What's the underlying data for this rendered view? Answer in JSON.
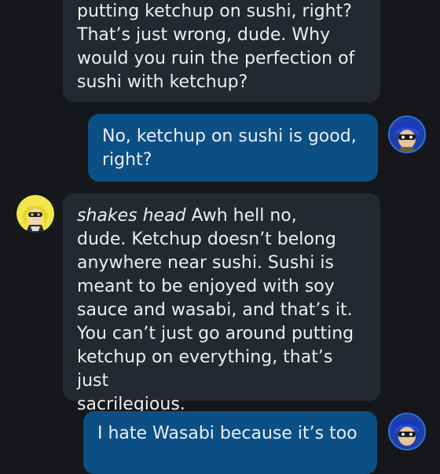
{
  "messages": [
    {
      "role": "bot",
      "text": "putting ketchup on sushi, right?\nThat’s just wrong, dude. Why\nwould you ruin the perfection of\nsushi with ketchup?"
    },
    {
      "role": "user",
      "text": "No, ketchup on sushi is good,\nright?"
    },
    {
      "role": "bot",
      "action": "shakes head",
      "text": " Awh hell no,\ndude. Ketchup doesn’t belong\nanywhere near sushi. Sushi is\nmeant to be enjoyed with soy\nsauce and wasabi, and that’s it.\nYou can’t just go around putting\nketchup on everything, that’s just\nsacrilegious."
    },
    {
      "role": "user",
      "text": "I hate Wasabi because it’s too"
    }
  ],
  "colors": {
    "background": "#16171b",
    "bot_bubble": "#25282f",
    "user_bubble": "#0b4f85",
    "text": "#eceef2",
    "user_avatar_ring": "#2b73e2"
  },
  "avatars": {
    "user_icon": "blue-squid-character-icon",
    "bot_icon": "yellow-squid-character-icon"
  }
}
